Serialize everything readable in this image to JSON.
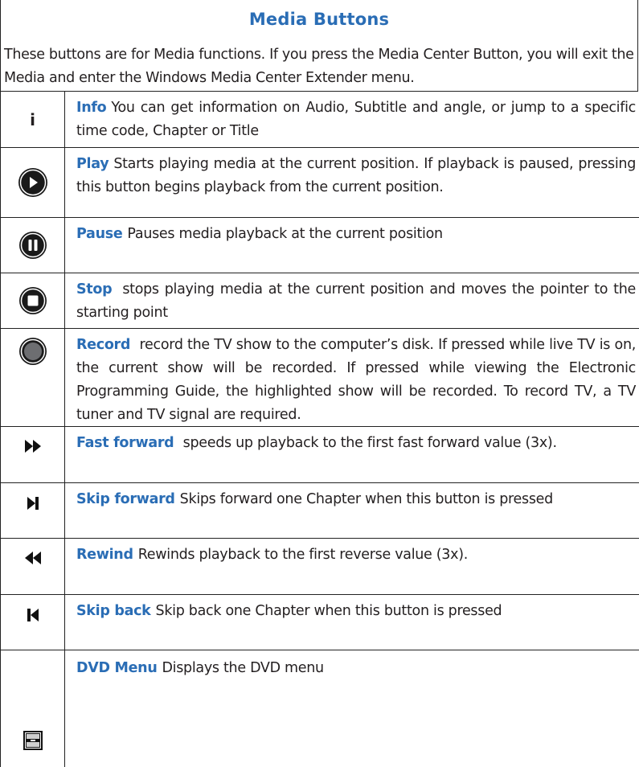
{
  "title": "Media Buttons",
  "intro": "These buttons are for Media functions. If you press the Media Center Button, you will exit the Media and enter the Windows Media Center Extender menu.",
  "buttons": [
    {
      "icon": "info-icon",
      "glyph": "i",
      "name": "Info",
      "desc": "You can  get information on Audio, Subtitle and angle, or jump to a specific time code, Chapter or Title"
    },
    {
      "icon": "play-icon",
      "name": "Play",
      "desc": "Starts playing media at the current position. If playback is paused, pressing this button begins playback from the current position."
    },
    {
      "icon": "pause-icon",
      "name": "Pause",
      "desc": "Pauses media playback at the current position"
    },
    {
      "icon": "stop-icon",
      "name": "Stop",
      "desc": " stops playing media at the current position and moves the pointer to the starting point"
    },
    {
      "icon": "record-icon",
      "name": "Record",
      "desc": " record the TV show to the computer’s disk. If pressed while live TV is on, the current show will be recorded. If pressed while viewing the Electronic Programming Guide, the highlighted show will be recorded. To record TV, a TV tuner and TV signal are required."
    },
    {
      "icon": "fast-forward-icon",
      "name": "Fast forward",
      "desc": " speeds up playback to the first fast forward value (3x)."
    },
    {
      "icon": "skip-forward-icon",
      "name": "Skip forward",
      "desc": "Skips forward one Chapter when this button is pressed"
    },
    {
      "icon": "rewind-icon",
      "name": "Rewind",
      "desc": "Rewinds playback to the first reverse value (3x)."
    },
    {
      "icon": "skip-back-icon",
      "name": "Skip back",
      "desc": "Skip back one Chapter when this button is pressed"
    },
    {
      "icon": "dvd-menu-icon",
      "name": "DVD Menu",
      "desc": "Displays the DVD menu"
    }
  ]
}
